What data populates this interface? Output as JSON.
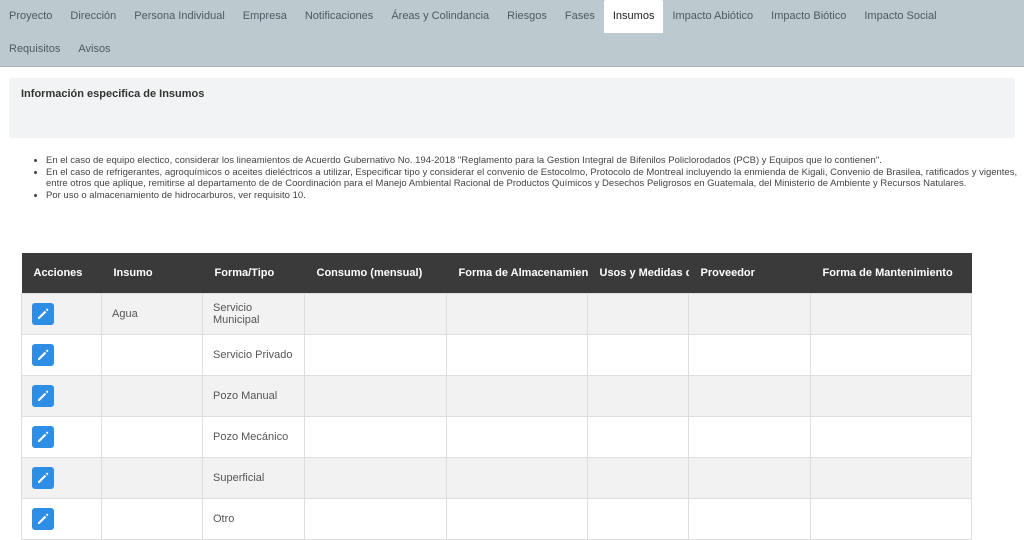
{
  "tabs_row1": [
    {
      "label": "Proyecto",
      "active": false
    },
    {
      "label": "Dirección",
      "active": false
    },
    {
      "label": "Persona Individual",
      "active": false
    },
    {
      "label": "Empresa",
      "active": false
    },
    {
      "label": "Notificaciones",
      "active": false
    },
    {
      "label": "Áreas y Colindancia",
      "active": false
    },
    {
      "label": "Riesgos",
      "active": false
    },
    {
      "label": "Fases",
      "active": false
    },
    {
      "label": "Insumos",
      "active": true
    },
    {
      "label": "Impacto Abiótico",
      "active": false
    },
    {
      "label": "Impacto Biótico",
      "active": false
    },
    {
      "label": "Impacto Social",
      "active": false
    }
  ],
  "tabs_row2": [
    {
      "label": "Requisitos",
      "active": false
    },
    {
      "label": "Avisos",
      "active": false
    }
  ],
  "panel": {
    "title": "Información especifica de Insumos"
  },
  "notes": [
    "En el caso de equipo electico, considerar los lineamientos de Acuerdo Gubernativo No. 194-2018 \"Reglamento para la Gestion Integral de Bifenilos Policlorodados (PCB) y Equipos que lo contienen\".",
    "En el caso de refrigerantes, agroquímicos o aceites dieléctricos a utilizar, Especificar tipo y considerar el convenio de Estocolmo, Protocolo de Montreal incluyendo la enmienda de Kigali, Convenio de Brasilea, ratificados y vigentes, entre otros que aplique, remitirse al departamento de de Coordinación para el Manejo Ambiental Racional de Productos Químicos y Desechos Peligrosos en Guatemala, del Ministerio de Ambiente y Recursos Natulares.",
    "Por uso o almacenamiento de hidrocarburos, ver requisito 10."
  ],
  "table": {
    "headers": [
      "Acciones",
      "Insumo",
      "Forma/Tipo",
      "Consumo (mensual)",
      "Forma de Almacenamiento",
      "Usos y Medidas de",
      "Proveedor",
      "Forma de Mantenimiento"
    ],
    "rows": [
      {
        "insumo": "Agua",
        "forma": "Servicio Municipal"
      },
      {
        "insumo": "",
        "forma": "Servicio Privado"
      },
      {
        "insumo": "",
        "forma": "Pozo Manual"
      },
      {
        "insumo": "",
        "forma": "Pozo Mecánico"
      },
      {
        "insumo": "",
        "forma": "Superficial"
      },
      {
        "insumo": "",
        "forma": "Otro"
      }
    ]
  },
  "colors": {
    "tabbar": "#bcc9ce",
    "header": "#3a3a3a",
    "edit_button": "#2e8ee6"
  }
}
